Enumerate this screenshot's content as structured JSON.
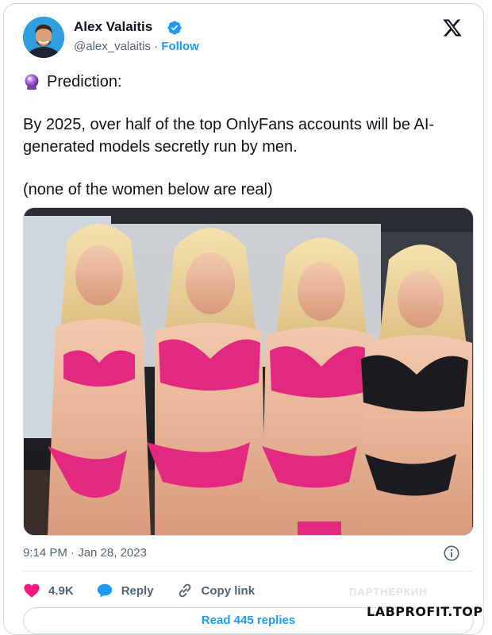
{
  "user": {
    "name": "Alex Valaitis",
    "handle": "@alex_valaitis",
    "separator": " · ",
    "follow_label": "Follow"
  },
  "tweet": {
    "line1": "Prediction:",
    "line2": "By 2025, over half of the top OnlyFans accounts will be AI-generated models secretly run by men.",
    "line3": "(none of the women below are real)"
  },
  "media": {
    "alt": "Four blonde women in pink and black lingerie posing together"
  },
  "meta": {
    "timestamp": "9:14 PM · Jan 28, 2023"
  },
  "actions": {
    "like_count": "4.9K",
    "reply_label": "Reply",
    "copy_label": "Copy link"
  },
  "replies_button": "Read 445 replies",
  "watermark": "LABPROFIT.TOP",
  "watermark_ghost": "ПАРТНЕРКИН",
  "colors": {
    "accent": "#1d9bf0",
    "like": "#f91880",
    "text": "#0f1419",
    "muted": "#536471"
  }
}
